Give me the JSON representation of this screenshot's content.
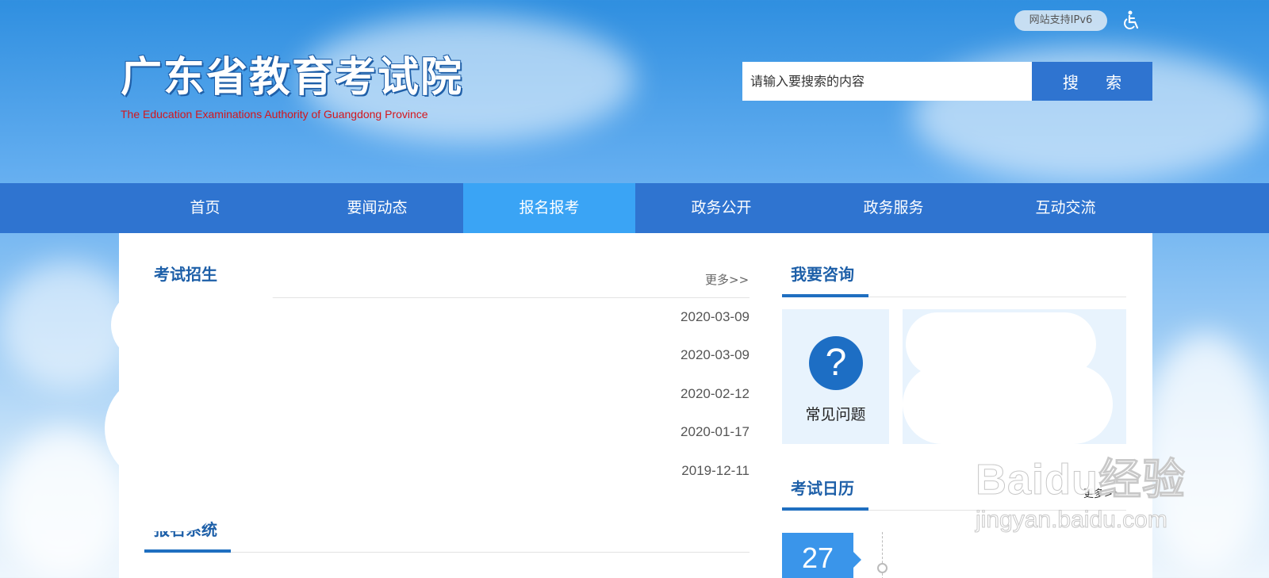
{
  "header": {
    "logo_title": "广东省教育考试院",
    "logo_subtitle": "The Education Examinations Authority of Guangdong Province",
    "ipv6_badge": "网站支持IPv6",
    "accessibility_icon": "wheelchair-icon",
    "search": {
      "placeholder": "请输入要搜索的内容",
      "button_label": "搜 索"
    }
  },
  "nav": {
    "items": [
      {
        "label": "首页",
        "active": false
      },
      {
        "label": "要闻动态",
        "active": false
      },
      {
        "label": "报名报考",
        "active": true
      },
      {
        "label": "政务公开",
        "active": false
      },
      {
        "label": "政务服务",
        "active": false
      },
      {
        "label": "互动交流",
        "active": false
      }
    ],
    "active_color": "#3aa4f5",
    "bar_color": "#2f74d0"
  },
  "exam_recruitment": {
    "title": "考试招生",
    "more": "更多>>",
    "dates": [
      "2020-03-09",
      "2020-03-09",
      "2020-02-12",
      "2020-01-17",
      "2019-12-11"
    ]
  },
  "registration_system": {
    "title": "报名系统"
  },
  "consult": {
    "title": "我要咨询",
    "faq_label": "常见问题",
    "faq_icon": "question-mark-icon"
  },
  "exam_calendar": {
    "title": "考试日历",
    "more": "更多>>",
    "day": "27"
  },
  "watermark": {
    "top": "Baidu经验",
    "bottom": "jingyan.baidu.com"
  }
}
